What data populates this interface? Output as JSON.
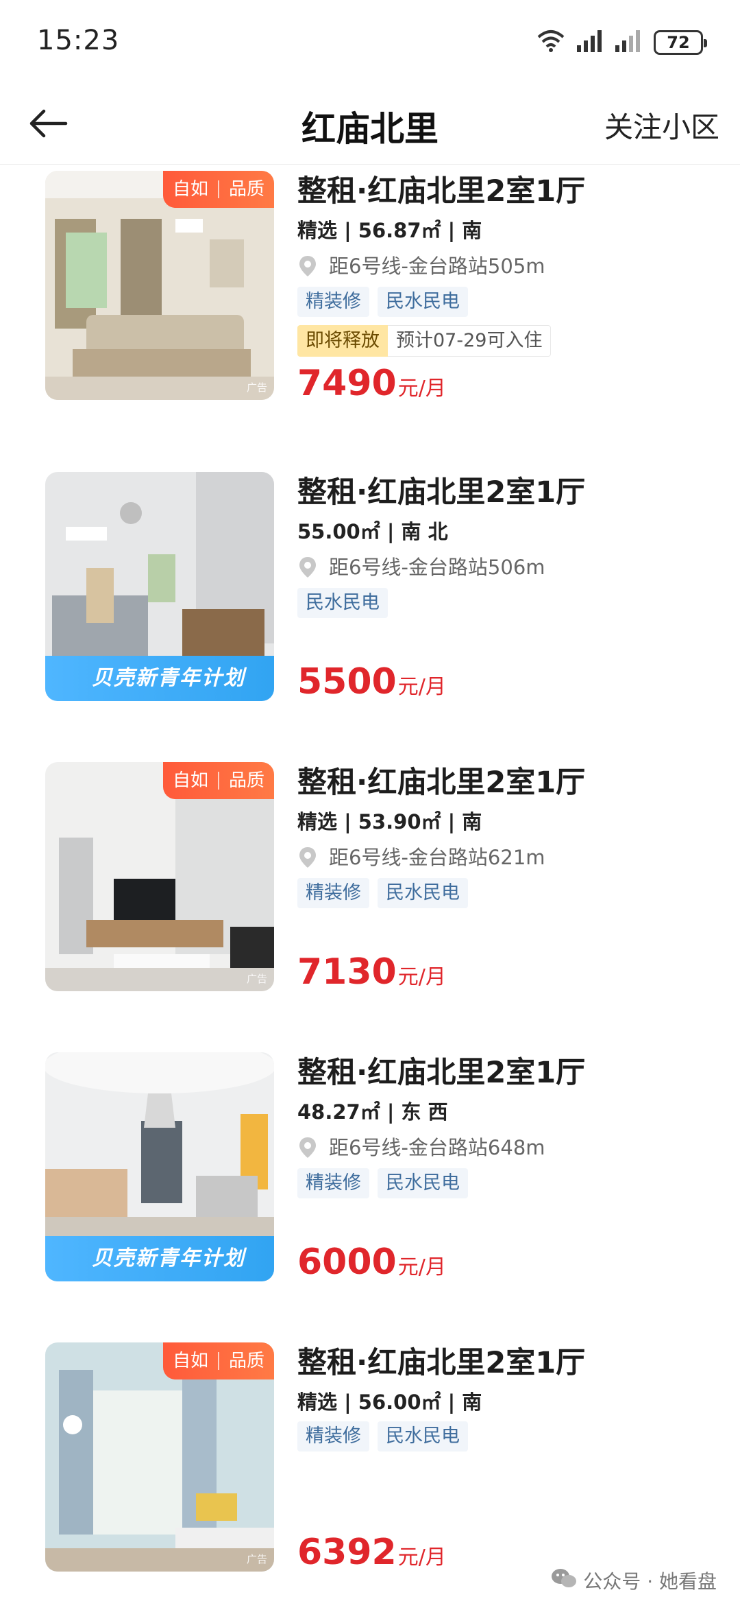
{
  "status_bar": {
    "time": "15:23",
    "battery": "72"
  },
  "header": {
    "title": "红庙北里",
    "follow_label": "关注小区"
  },
  "listings": [
    {
      "badges": [
        "自如",
        "品质"
      ],
      "title": "整租·红庙北里2室1厅",
      "meta": "精选 | 56.87㎡ | 南",
      "distance": "距6号线-金台路站505m",
      "tags": [
        "精装修",
        "民水民电"
      ],
      "release_tag": "即将释放",
      "release_date": "预计07-29可入住",
      "price": "7490",
      "price_unit": "元/月",
      "ad_label": "广告"
    },
    {
      "banner": "贝壳新青年计划",
      "title": "整租·红庙北里2室1厅",
      "meta": "55.00㎡ | 南 北",
      "distance": "距6号线-金台路站506m",
      "tags": [
        "民水民电"
      ],
      "price": "5500",
      "price_unit": "元/月"
    },
    {
      "badges": [
        "自如",
        "品质"
      ],
      "title": "整租·红庙北里2室1厅",
      "meta": "精选 | 53.90㎡ | 南",
      "distance": "距6号线-金台路站621m",
      "tags": [
        "精装修",
        "民水民电"
      ],
      "price": "7130",
      "price_unit": "元/月",
      "ad_label": "广告"
    },
    {
      "banner": "贝壳新青年计划",
      "title": "整租·红庙北里2室1厅",
      "meta": "48.27㎡ | 东 西",
      "distance": "距6号线-金台路站648m",
      "tags": [
        "精装修",
        "民水民电"
      ],
      "price": "6000",
      "price_unit": "元/月"
    },
    {
      "badges": [
        "自如",
        "品质"
      ],
      "title": "整租·红庙北里2室1厅",
      "meta": "精选 | 56.00㎡ | 南",
      "tags": [
        "精装修",
        "民水民电"
      ],
      "price": "6392",
      "price_unit": "元/月",
      "ad_label": "广告"
    }
  ],
  "watermark": "公众号 · 她看盘",
  "colors": {
    "price": "#e0262b",
    "badge": "#ff6a40",
    "banner": "#3aa9f5",
    "tag_text": "#3f6d9d"
  }
}
